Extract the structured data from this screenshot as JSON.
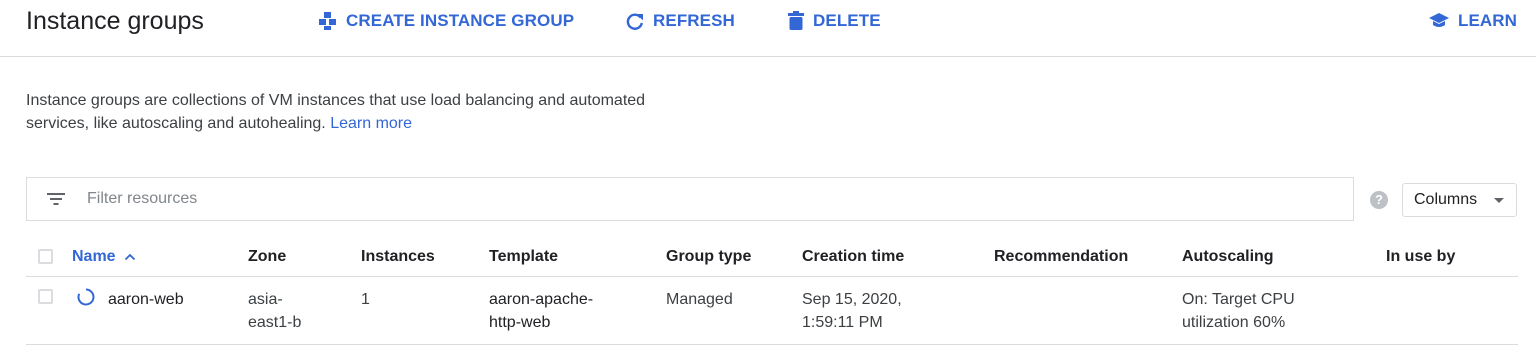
{
  "header": {
    "title": "Instance groups",
    "create_label": "CREATE INSTANCE GROUP",
    "refresh_label": "REFRESH",
    "delete_label": "DELETE",
    "learn_label": "LEARN"
  },
  "description": {
    "text": "Instance groups are collections of VM instances that use load balancing and automated services, like autoscaling and autohealing.",
    "link": "Learn more"
  },
  "filter": {
    "placeholder": "Filter resources",
    "help_glyph": "?",
    "columns_label": "Columns"
  },
  "table": {
    "columns": [
      "Name",
      "Zone",
      "Instances",
      "Template",
      "Group type",
      "Creation time",
      "Recommendation",
      "Autoscaling",
      "In use by"
    ],
    "sort_indicator": "^",
    "rows": [
      {
        "status": "loading",
        "name": "aaron-web",
        "zone": "asia-east1-b",
        "instances": "1",
        "template": "aaron-apache-http-web",
        "group_type": "Managed",
        "creation_time": "Sep 15, 2020, 1:59:11 PM",
        "recommendation": "",
        "autoscaling": "On: Target CPU utilization 60%",
        "in_use_by": ""
      }
    ]
  },
  "colors": {
    "accent": "#3367d6",
    "border": "#dadce0",
    "text": "#202124"
  }
}
